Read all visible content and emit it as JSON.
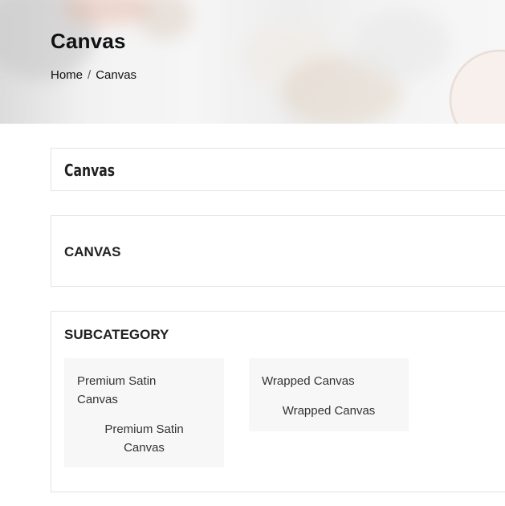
{
  "header": {
    "title": "Canvas",
    "breadcrumb": {
      "home": "Home",
      "separator": "/",
      "current": "Canvas"
    }
  },
  "category_box": {
    "title": "Canvas"
  },
  "canvas_box": {
    "title": "CANVAS"
  },
  "subcategory": {
    "title": "SUBCATEGORY",
    "items": [
      {
        "link": "Premium Satin Canvas",
        "label": "Premium Satin Canvas"
      },
      {
        "link": "Wrapped Canvas",
        "label": "Wrapped Canvas"
      }
    ]
  }
}
